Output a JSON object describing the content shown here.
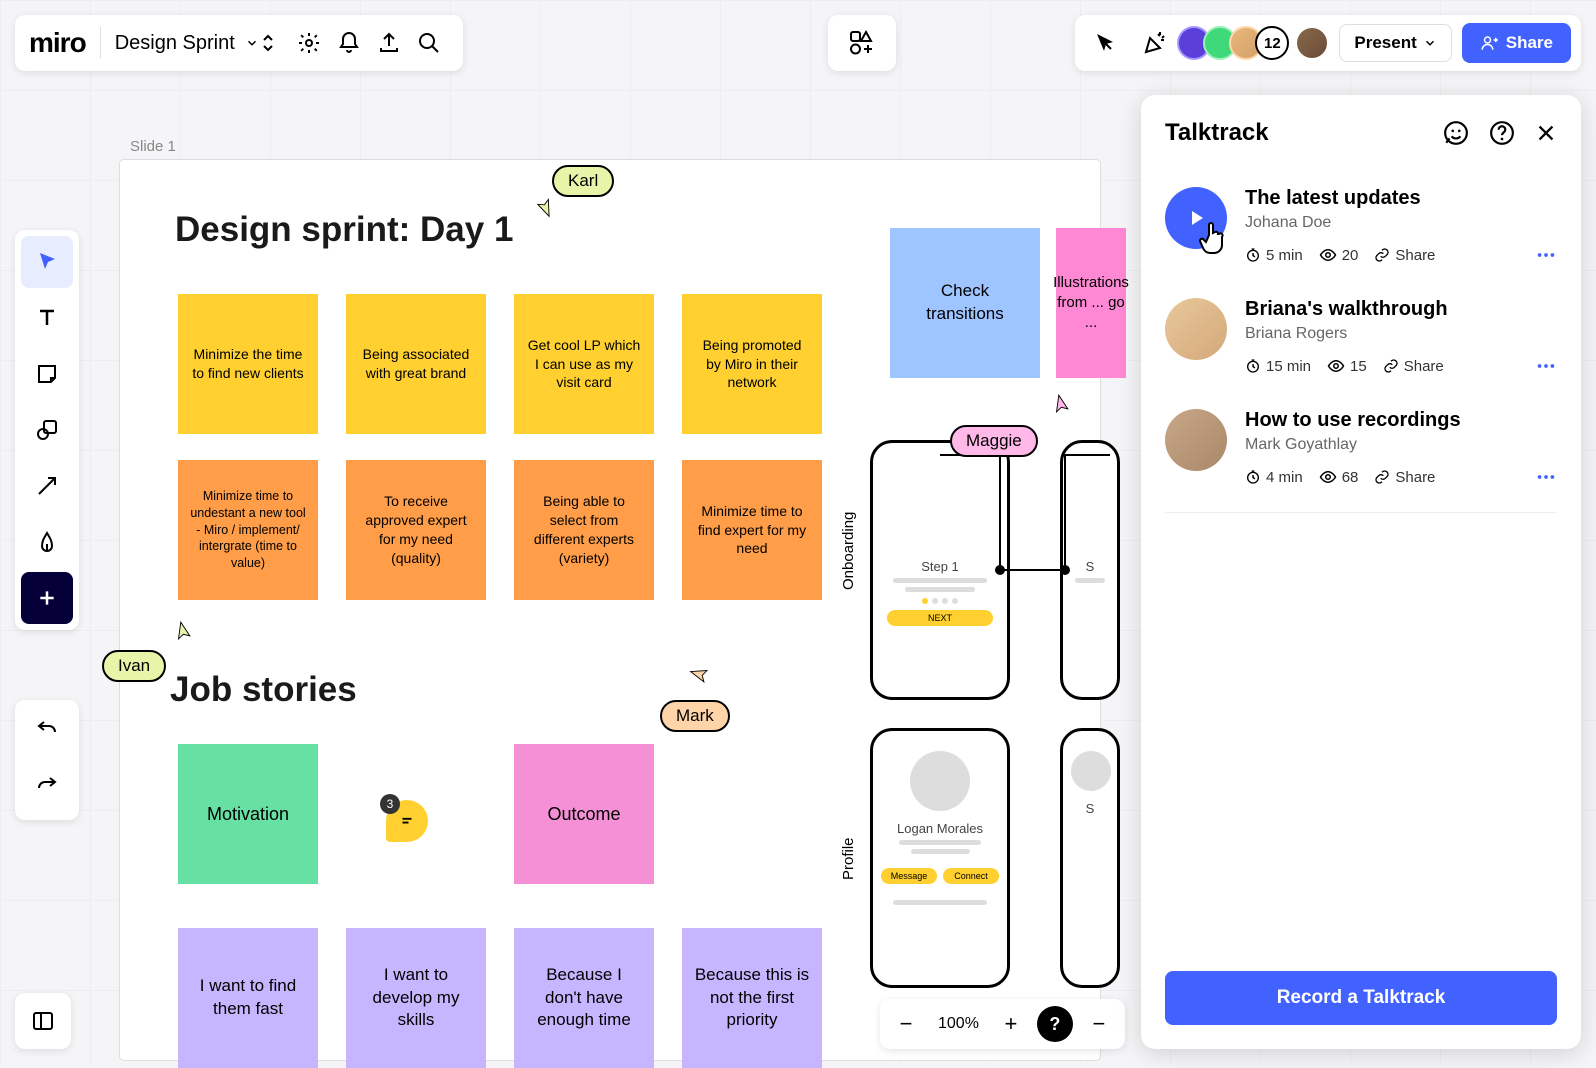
{
  "app": {
    "logo": "miro",
    "board_name": "Design Sprint"
  },
  "topbar": {
    "present": "Present",
    "share": "Share",
    "avatar_count": "12"
  },
  "slide": {
    "label": "Slide 1",
    "title": "Design sprint: Day 1",
    "subtitle": "Job stories"
  },
  "stickies_row1": [
    "Minimize the time to find new clients",
    "Being associated with great brand",
    "Get cool LP which I can use as my visit card",
    "Being promoted by Miro in their network"
  ],
  "stickies_row2": [
    "Minimize time to undestant a new tool - Miro / implement/ intergrate (time to value)",
    "To receive approved expert for my need (quality)",
    "Being able to select from different experts (variety)",
    "Minimize time to find expert for my need"
  ],
  "stickies_row3": [
    "Motivation",
    "Outcome"
  ],
  "stickies_row4": [
    "I want to find them fast",
    "I want to develop my skills",
    "Because I don't have enough time",
    "Because this is not the first priority"
  ],
  "stickies_side": [
    "Check transitions",
    "Illustrations from ... go ..."
  ],
  "cursors": {
    "karl": "Karl",
    "ivan": "Ivan",
    "mark": "Mark",
    "maggie": "Maggie"
  },
  "comment_count": "3",
  "wireframes": {
    "onboarding_label": "Onboarding",
    "profile_label": "Profile",
    "step": "Step 1",
    "next": "NEXT",
    "profile_name": "Logan Morales",
    "btn1": "Message",
    "btn2": "Connect",
    "s_label": "S"
  },
  "zoom": {
    "value": "100%"
  },
  "talktrack": {
    "title": "Talktrack",
    "record": "Record a Talktrack",
    "share": "Share",
    "items": [
      {
        "title": "The latest updates",
        "author": "Johana Doe",
        "duration": "5 min",
        "views": "20"
      },
      {
        "title": "Briana's walkthrough",
        "author": "Briana Rogers",
        "duration": "15 min",
        "views": "15"
      },
      {
        "title": "How to use recordings",
        "author": "Mark Goyathlay",
        "duration": "4 min",
        "views": "68"
      }
    ]
  }
}
